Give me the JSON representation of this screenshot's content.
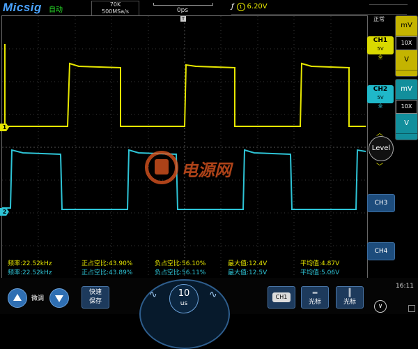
{
  "header": {
    "logo": "Micsig",
    "mode": "自动",
    "samples": "70K",
    "sample_rate": "500MSa/s",
    "time_position": "0ps",
    "trigger_slope": "ƒ",
    "trigger_channel": "1",
    "trigger_level": "6.20V"
  },
  "markers": {
    "ch1": "1",
    "ch2": "2",
    "trigger_time": "T"
  },
  "watermark": "电源网",
  "measurements": {
    "ch1": {
      "freq": "频率:22.52kHz",
      "pos_duty": "正占空比:43.90%",
      "neg_duty": "负占空比:56.10%",
      "max": "最大值:12.4V",
      "avg": "平均值:4.87V"
    },
    "ch2": {
      "freq": "频率:22.52kHz",
      "pos_duty": "正占空比:43.89%",
      "neg_duty": "负占空比:56.11%",
      "max": "最大值:12.5V",
      "avg": "平均值:5.06V"
    }
  },
  "right_panel": {
    "status": "正常",
    "ch1": {
      "label": "CH1",
      "scale": "5V",
      "bw": "全"
    },
    "ch2": {
      "label": "CH2",
      "scale": "5V",
      "bw": "全"
    },
    "side1": {
      "unit_top": "mV",
      "probe": "10X",
      "unit_bottom": "V"
    },
    "side2": {
      "unit_top": "mV",
      "probe": "10X",
      "unit_bottom": "V"
    },
    "level": "Level",
    "ch3": "CH3",
    "ch4": "CH4"
  },
  "bottom": {
    "fine": "微调",
    "quick_save_1": "快速",
    "quick_save_2": "保存",
    "timebase_value": "10",
    "timebase_unit": "us",
    "ch_select": "CH1",
    "cursor_h": "光标",
    "cursor_v": "光标",
    "clock": "16:11"
  },
  "colors": {
    "ch1": "#e6e600",
    "ch2": "#2ec4d6",
    "accent": "#2f6fb3"
  }
}
